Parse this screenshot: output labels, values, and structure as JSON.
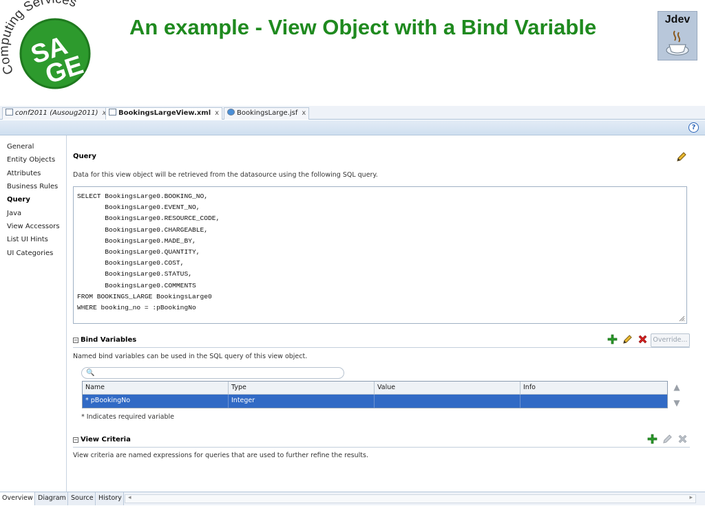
{
  "slide": {
    "title": "An example - View Object with a  Bind Variable",
    "logo_arc_text": "Computing Services",
    "logo_text_top": "SA",
    "logo_text_bottom": "GE",
    "badge_label": "Jdev"
  },
  "editor_tabs": [
    {
      "label": "conf2011 (Ausoug2011)",
      "close": "x",
      "active": false
    },
    {
      "label": "BookingsLargeView.xml",
      "close": "x",
      "active": true
    },
    {
      "label": "BookingsLarge.jsf",
      "close": "x",
      "active": false
    }
  ],
  "help_label": "?",
  "nav": {
    "items": [
      {
        "label": "General",
        "active": false
      },
      {
        "label": "Entity Objects",
        "active": false
      },
      {
        "label": "Attributes",
        "active": false
      },
      {
        "label": "Business Rules",
        "active": false
      },
      {
        "label": "Query",
        "active": true
      },
      {
        "label": "Java",
        "active": false
      },
      {
        "label": "View Accessors",
        "active": false
      },
      {
        "label": "List UI Hints",
        "active": false
      },
      {
        "label": "UI Categories",
        "active": false
      }
    ]
  },
  "query": {
    "title": "Query",
    "description": "Data for this view object will be retrieved from the datasource using the following SQL query.",
    "sql": "SELECT BookingsLarge0.BOOKING_NO,\n       BookingsLarge0.EVENT_NO,\n       BookingsLarge0.RESOURCE_CODE,\n       BookingsLarge0.CHARGEABLE,\n       BookingsLarge0.MADE_BY,\n       BookingsLarge0.QUANTITY,\n       BookingsLarge0.COST,\n       BookingsLarge0.STATUS,\n       BookingsLarge0.COMMENTS\nFROM BOOKINGS_LARGE BookingsLarge0\nWHERE booking_no = :pBookingNo"
  },
  "bind_variables": {
    "title": "Bind Variables",
    "description": "Named bind variables can be used in the SQL query of this view object.",
    "override_label": "Override...",
    "search_placeholder": "",
    "columns": [
      "Name",
      "Type",
      "Value",
      "Info"
    ],
    "rows": [
      {
        "name": "* pBookingNo",
        "type": "Integer",
        "value": "",
        "info": ""
      }
    ],
    "footnote": "* Indicates required variable"
  },
  "view_criteria": {
    "title": "View Criteria",
    "description": "View criteria are named expressions for queries that are used to further refine the results."
  },
  "bottom_tabs": [
    {
      "label": "Overview",
      "active": true
    },
    {
      "label": "Diagram",
      "active": false
    },
    {
      "label": "Source",
      "active": false
    },
    {
      "label": "History",
      "active": false
    }
  ],
  "colors": {
    "title_green": "#1f8a1f",
    "selection_blue": "#316ac5",
    "add_green": "#2a9a2a",
    "delete_red": "#d22020"
  }
}
